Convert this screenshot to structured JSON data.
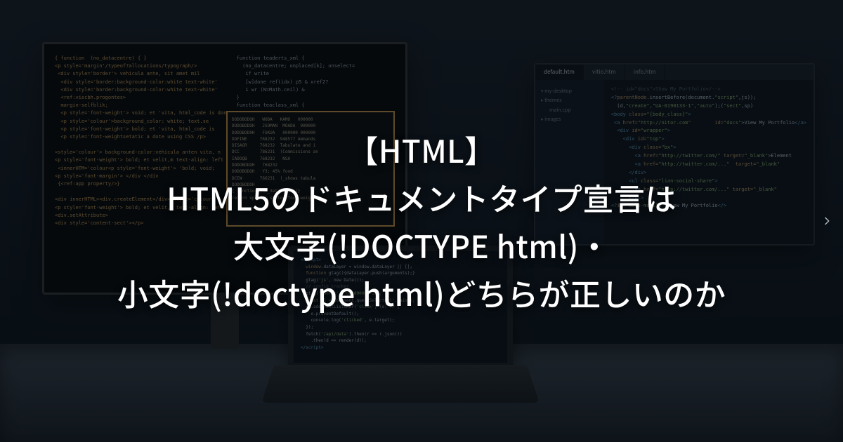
{
  "title": {
    "line1": "【HTML】",
    "line2": "HTML5のドキュメントタイプ宣言は",
    "line3": "大文字(!DOCTYPE html)・",
    "line4": "小文字(!doctype html)どちらが正しいのか"
  },
  "nav": {
    "next_label": "next"
  },
  "editor": {
    "tabs": {
      "t1": "default.htm",
      "t2": "vitio.htm",
      "t3": "info.htm"
    },
    "sidebar": {
      "s1": "my-desktop",
      "s2": "themes",
      "s3": "main.cpp",
      "s4": "images"
    }
  }
}
